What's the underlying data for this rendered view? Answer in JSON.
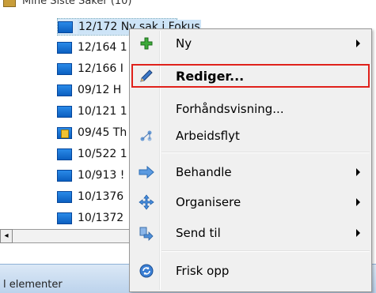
{
  "tree": {
    "header_text": "Mine Siste Saker (10)",
    "rows": [
      {
        "label": "12/172 Ny sak i Fokus",
        "selected": true,
        "locked": false
      },
      {
        "label": "12/164 1",
        "selected": false,
        "locked": false
      },
      {
        "label": "12/166 I",
        "selected": false,
        "locked": false
      },
      {
        "label": "09/12 H",
        "selected": false,
        "locked": false
      },
      {
        "label": "10/121 1",
        "selected": false,
        "locked": false
      },
      {
        "label": "09/45 Th",
        "selected": false,
        "locked": true
      },
      {
        "label": "10/522 1",
        "selected": false,
        "locked": false
      },
      {
        "label": "10/913 !",
        "selected": false,
        "locked": false
      },
      {
        "label": "10/1376",
        "selected": false,
        "locked": false
      },
      {
        "label": "10/1372",
        "selected": false,
        "locked": false
      }
    ],
    "scroll_left_glyph": "◂",
    "status_text": "l elementer"
  },
  "menu": {
    "items": [
      {
        "label": "Ny",
        "icon": "plus-icon",
        "submenu": true,
        "bold": false,
        "highlight": false
      },
      {
        "label": "Rediger...",
        "icon": "pencil-icon",
        "submenu": false,
        "bold": true,
        "highlight": true
      },
      {
        "label": "Forhåndsvisning...",
        "icon": "",
        "submenu": false,
        "bold": false,
        "highlight": false
      },
      {
        "label": "Arbeidsflyt",
        "icon": "workflow-icon",
        "submenu": false,
        "bold": false,
        "highlight": false
      },
      {
        "label": "Behandle",
        "icon": "process-arrow-icon",
        "submenu": true,
        "bold": false,
        "highlight": false
      },
      {
        "label": "Organisere",
        "icon": "move-arrows-icon",
        "submenu": true,
        "bold": false,
        "highlight": false
      },
      {
        "label": "Send til",
        "icon": "send-to-icon",
        "submenu": true,
        "bold": false,
        "highlight": false
      },
      {
        "label": "Frisk opp",
        "icon": "refresh-icon",
        "submenu": false,
        "bold": false,
        "highlight": false
      }
    ]
  },
  "colors": {
    "highlight_border": "#e0211b",
    "folder_blue": "#1a74d6",
    "selection": "#d8e9f9"
  }
}
